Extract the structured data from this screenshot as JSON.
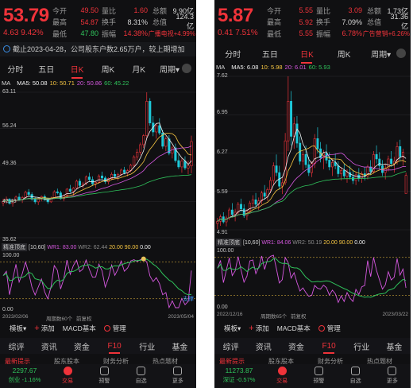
{
  "left": {
    "price": "53.79",
    "change": "4.63",
    "change_pct": "9.42%",
    "quote_rows": [
      {
        "l1": "今开",
        "v1": "49.50",
        "l2": "量比",
        "v2": "1.60",
        "l3": "总额",
        "v3": "9.90亿"
      },
      {
        "l1": "最高",
        "v1": "54.87",
        "l2": "换手",
        "v2": "8.31%",
        "l3": "总值",
        "v3": "124.3亿"
      },
      {
        "l1": "最低",
        "v1": "47.80",
        "l2": "振幅",
        "v2": "14.38%",
        "l3": "",
        "v3": "广播电视+4.99%"
      }
    ],
    "notice": "截止2023-04-28，公司股东户数2.65万户，较上期增加",
    "period_tabs": [
      "分时",
      "五日",
      "日K",
      "周K",
      "月K",
      "周期▾"
    ],
    "active_period": 2,
    "ma": {
      "label": "MA",
      "ma5": "MA5: 50.08",
      "ma10": "10: 50.71",
      "ma20": "20: 50.86",
      "ma60": "60: 45.22"
    },
    "y_ticks": [
      "63.11",
      "56.24",
      "49.36",
      "42.49",
      "35.62"
    ],
    "ind": {
      "name": "精准顶底",
      "params": "[10,60]",
      "wr1": "WR1: 83.00",
      "wr2": "WR2: 62.44",
      "v20": "20.00",
      "v90": "90.00",
      "v0": "0.00"
    },
    "ind_top": "100.00",
    "ind_bottom": "0.00",
    "ind_tag": "支撑",
    "dates": {
      "start": "2023/02/06",
      "mid1": "周期数60个",
      "mid2": "前复权",
      "end": "2023/05/04"
    },
    "chart_data": {
      "type": "candlestick",
      "ylim": [
        35.62,
        63.11
      ],
      "ohlc": [
        [
          42.2,
          43.0,
          41.6,
          42.5
        ],
        [
          42.5,
          43.4,
          42.0,
          42.9
        ],
        [
          42.9,
          43.1,
          41.9,
          42.1
        ],
        [
          42.1,
          42.8,
          41.5,
          42.6
        ],
        [
          42.6,
          43.6,
          42.3,
          43.3
        ],
        [
          43.3,
          44.0,
          42.6,
          42.8
        ],
        [
          42.8,
          43.5,
          42.2,
          43.2
        ],
        [
          43.2,
          44.5,
          42.9,
          44.2
        ],
        [
          44.2,
          44.8,
          43.4,
          43.8
        ],
        [
          43.8,
          44.2,
          42.6,
          42.9
        ],
        [
          42.9,
          43.4,
          42.0,
          42.4
        ],
        [
          42.4,
          43.1,
          41.8,
          42.9
        ],
        [
          42.9,
          43.6,
          42.5,
          43.4
        ],
        [
          43.4,
          43.8,
          42.6,
          42.8
        ],
        [
          42.8,
          43.2,
          42.0,
          42.4
        ],
        [
          42.4,
          43.4,
          42.2,
          43.1
        ],
        [
          43.1,
          44.6,
          42.9,
          44.3
        ],
        [
          44.3,
          44.9,
          43.8,
          44.1
        ],
        [
          44.1,
          44.5,
          42.8,
          43.0
        ],
        [
          43.0,
          43.8,
          42.5,
          43.6
        ],
        [
          43.6,
          45.0,
          43.2,
          44.8
        ],
        [
          44.8,
          45.6,
          44.1,
          44.4
        ],
        [
          44.4,
          45.2,
          43.6,
          45.0
        ],
        [
          45.0,
          46.6,
          44.8,
          46.3
        ],
        [
          46.3,
          46.8,
          45.2,
          45.5
        ],
        [
          45.5,
          46.2,
          44.9,
          45.8
        ],
        [
          45.8,
          47.4,
          45.6,
          47.1
        ],
        [
          47.1,
          47.9,
          46.2,
          46.6
        ],
        [
          46.6,
          47.2,
          45.4,
          45.8
        ],
        [
          45.8,
          46.4,
          45.0,
          46.1
        ],
        [
          46.1,
          47.6,
          45.9,
          47.3
        ],
        [
          47.3,
          48.1,
          46.6,
          46.9
        ],
        [
          46.9,
          47.3,
          45.8,
          46.2
        ],
        [
          46.2,
          47.0,
          45.7,
          46.8
        ],
        [
          46.8,
          48.0,
          46.5,
          47.6
        ],
        [
          47.6,
          48.4,
          46.9,
          47.2
        ],
        [
          47.2,
          47.9,
          46.4,
          47.6
        ],
        [
          47.6,
          48.7,
          47.2,
          48.4
        ],
        [
          48.4,
          49.0,
          47.6,
          47.9
        ],
        [
          47.9,
          48.6,
          47.2,
          48.3
        ],
        [
          48.3,
          49.6,
          48.0,
          49.3
        ],
        [
          49.3,
          51.2,
          49.0,
          50.9
        ],
        [
          50.9,
          52.4,
          50.2,
          51.8
        ],
        [
          51.8,
          53.6,
          51.2,
          53.2
        ],
        [
          53.2,
          55.2,
          52.6,
          54.9
        ],
        [
          54.9,
          63.1,
          54.2,
          61.4
        ],
        [
          61.4,
          62.0,
          56.8,
          57.3
        ],
        [
          57.3,
          58.6,
          54.8,
          55.6
        ],
        [
          55.6,
          57.2,
          54.3,
          56.8
        ],
        [
          56.8,
          58.2,
          55.0,
          55.4
        ],
        [
          55.4,
          56.0,
          52.4,
          52.9
        ],
        [
          52.9,
          54.8,
          52.0,
          54.3
        ],
        [
          54.3,
          55.0,
          51.2,
          51.6
        ],
        [
          51.6,
          53.0,
          50.6,
          52.6
        ],
        [
          52.6,
          53.4,
          49.8,
          50.2
        ],
        [
          50.2,
          51.4,
          48.6,
          49.0
        ],
        [
          49.0,
          50.6,
          47.9,
          50.1
        ],
        [
          50.1,
          51.0,
          48.4,
          48.8
        ],
        [
          48.8,
          50.2,
          47.6,
          49.2
        ],
        [
          49.2,
          54.9,
          47.8,
          53.8
        ]
      ]
    }
  },
  "right": {
    "price": "5.87",
    "change": "0.41",
    "change_pct": "7.51%",
    "quote_rows": [
      {
        "l1": "今开",
        "v1": "5.55",
        "l2": "量比",
        "v2": "3.09",
        "l3": "总额",
        "v3": "1.73亿"
      },
      {
        "l1": "最高",
        "v1": "5.92",
        "l2": "换手",
        "v2": "7.09%",
        "l3": "总值",
        "v3": "31.36亿"
      },
      {
        "l1": "最低",
        "v1": "5.55",
        "l2": "振幅",
        "v2": "6.78%",
        "l3": "",
        "v3": "广告营销+6.26%"
      }
    ],
    "period_tabs": [
      "分时",
      "五日",
      "日K",
      "周K",
      "周期▾"
    ],
    "active_period": 2,
    "ma": {
      "label": "MA",
      "ma5": "MA5: 6.08",
      "ma10": "10: 5.98",
      "ma20": "20: 6.01",
      "ma60": "60: 5.93"
    },
    "y_ticks": [
      "7.62",
      "6.95",
      "6.27",
      "5.59",
      "4.91"
    ],
    "ind": {
      "name": "精准顶底",
      "params": "[10,60]",
      "wr1": "WR1: 84.06",
      "wr2": "WR2: 50.19",
      "v20": "20.00",
      "v90": "90.00",
      "v0": "0.00"
    },
    "ind_top": "100.00",
    "ind_bottom": "0.00",
    "dates": {
      "start": "2022/12/16",
      "mid1": "周期数65个",
      "mid2": "前复权",
      "end": "2023/03/22"
    },
    "chart_data": {
      "type": "candlestick",
      "ylim": [
        4.91,
        7.62
      ],
      "ohlc": [
        [
          5.02,
          5.12,
          4.92,
          5.06
        ],
        [
          5.06,
          5.18,
          4.98,
          5.14
        ],
        [
          5.14,
          5.22,
          5.02,
          5.05
        ],
        [
          5.05,
          5.16,
          4.97,
          5.12
        ],
        [
          5.12,
          5.3,
          5.08,
          5.26
        ],
        [
          5.26,
          5.38,
          5.14,
          5.18
        ],
        [
          5.18,
          5.28,
          5.06,
          5.22
        ],
        [
          5.22,
          5.4,
          5.16,
          5.36
        ],
        [
          5.36,
          5.46,
          5.22,
          5.28
        ],
        [
          5.28,
          5.36,
          5.12,
          5.16
        ],
        [
          5.16,
          5.28,
          5.08,
          5.24
        ],
        [
          5.24,
          5.42,
          5.2,
          5.38
        ],
        [
          5.38,
          5.52,
          5.3,
          5.44
        ],
        [
          5.44,
          5.56,
          5.32,
          5.36
        ],
        [
          5.36,
          5.48,
          5.26,
          5.42
        ],
        [
          5.42,
          5.6,
          5.36,
          5.56
        ],
        [
          5.56,
          5.7,
          5.44,
          5.5
        ],
        [
          5.5,
          5.66,
          5.42,
          5.62
        ],
        [
          5.62,
          5.84,
          5.56,
          5.78
        ],
        [
          5.78,
          6.1,
          5.7,
          6.04
        ],
        [
          6.04,
          6.24,
          5.86,
          5.92
        ],
        [
          5.92,
          6.04,
          5.62,
          5.68
        ],
        [
          5.68,
          5.82,
          5.54,
          5.74
        ],
        [
          5.74,
          6.62,
          5.7,
          6.48
        ],
        [
          6.48,
          7.62,
          6.3,
          7.18
        ],
        [
          7.18,
          7.36,
          6.4,
          6.56
        ],
        [
          6.56,
          6.9,
          6.34,
          6.78
        ],
        [
          6.78,
          6.92,
          6.36,
          6.44
        ],
        [
          6.44,
          6.56,
          6.06,
          6.12
        ],
        [
          6.12,
          6.3,
          5.96,
          6.24
        ],
        [
          6.24,
          6.4,
          6.0,
          6.06
        ],
        [
          6.06,
          6.2,
          5.86,
          5.92
        ],
        [
          5.92,
          6.12,
          5.84,
          6.08
        ],
        [
          6.08,
          6.6,
          6.0,
          6.52
        ],
        [
          6.52,
          6.72,
          6.26,
          6.34
        ],
        [
          6.34,
          6.46,
          6.1,
          6.18
        ],
        [
          6.18,
          6.32,
          5.98,
          6.26
        ],
        [
          6.26,
          6.42,
          6.08,
          6.14
        ],
        [
          6.14,
          6.28,
          5.96,
          6.02
        ],
        [
          6.02,
          6.16,
          5.86,
          6.1
        ],
        [
          6.1,
          6.26,
          5.98,
          6.04
        ],
        [
          6.04,
          6.12,
          5.84,
          5.9
        ],
        [
          5.9,
          6.02,
          5.78,
          5.96
        ],
        [
          5.96,
          6.08,
          5.82,
          5.86
        ],
        [
          5.86,
          5.98,
          5.74,
          5.92
        ],
        [
          5.92,
          6.04,
          5.8,
          5.84
        ],
        [
          5.84,
          5.96,
          5.72,
          5.78
        ],
        [
          5.78,
          5.92,
          5.7,
          5.88
        ],
        [
          5.88,
          6.0,
          5.76,
          5.82
        ],
        [
          5.82,
          5.94,
          5.74,
          5.9
        ],
        [
          5.9,
          6.02,
          5.78,
          5.86
        ],
        [
          5.86,
          6.06,
          5.8,
          6.02
        ],
        [
          6.02,
          6.14,
          5.88,
          5.94
        ],
        [
          5.94,
          6.3,
          5.9,
          6.24
        ],
        [
          6.24,
          6.4,
          6.08,
          6.16
        ],
        [
          6.16,
          6.28,
          5.98,
          6.04
        ],
        [
          6.04,
          6.14,
          5.86,
          5.92
        ],
        [
          5.92,
          6.06,
          5.8,
          6.0
        ],
        [
          6.0,
          6.22,
          5.94,
          6.16
        ],
        [
          6.16,
          6.3,
          6.02,
          6.08
        ],
        [
          6.08,
          6.2,
          5.92,
          6.12
        ],
        [
          6.12,
          6.46,
          6.06,
          6.38
        ],
        [
          6.38,
          6.5,
          6.12,
          6.2
        ],
        [
          6.2,
          6.34,
          6.04,
          6.28
        ],
        [
          5.55,
          5.92,
          5.55,
          5.87
        ]
      ]
    }
  },
  "f10_tabs": [
    "综评",
    "资讯",
    "资金",
    "F10",
    "行业",
    "基金"
  ],
  "f10_active": 3,
  "subtabs": [
    "最新提示",
    "股东股本",
    "财务分析",
    "热点题材"
  ],
  "toolbar": {
    "template": "模板▾",
    "add": "添加",
    "macd": "MACD基本",
    "manage": "管理"
  },
  "bottom_left": {
    "index_value": "2297.67",
    "index_name": "创业 -1.16%"
  },
  "bottom_right": {
    "index_value": "11273.87",
    "index_name": "深证 -0.57%"
  },
  "bottom_tabs": [
    "交易",
    "预警",
    "自选",
    "更多"
  ],
  "colors": {
    "up": "#f0333a",
    "down": "#2fc25b",
    "ma5": "#f0f0f0",
    "ma10": "#f5c542",
    "ma20": "#d658e0",
    "ma60": "#2fc25b"
  }
}
